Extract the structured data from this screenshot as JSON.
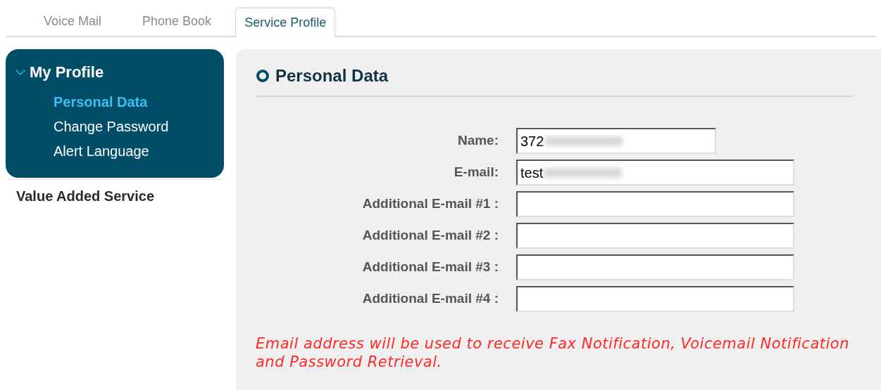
{
  "tabs": [
    {
      "label": "Voice Mail",
      "selected": false
    },
    {
      "label": "Phone Book",
      "selected": false
    },
    {
      "label": "Service Profile",
      "selected": true
    }
  ],
  "sidebar": {
    "title": "My Profile",
    "expanded": true,
    "items": [
      {
        "label": "Personal Data",
        "selected": true
      },
      {
        "label": "Change Password",
        "selected": false
      },
      {
        "label": "Alert Language",
        "selected": false
      }
    ],
    "other_section": "Value Added Service"
  },
  "panel": {
    "title": "Personal Data",
    "fields": [
      {
        "label": "Name:",
        "value": "372",
        "redacted": true,
        "wide": false
      },
      {
        "label": "E-mail:",
        "value": "test",
        "redacted": true,
        "wide": true
      },
      {
        "label": "Additional E-mail #1 :",
        "redacted": false,
        "wide": true
      },
      {
        "label": "Additional E-mail #2 :",
        "redacted": false,
        "wide": true
      },
      {
        "label": "Additional E-mail #3 :",
        "redacted": false,
        "wide": true
      },
      {
        "label": "Additional E-mail #4 :",
        "redacted": false,
        "wide": true
      }
    ],
    "note": "Email address will be used to receive Fax Notification, Voicemail Notification and Password Retrieval."
  }
}
